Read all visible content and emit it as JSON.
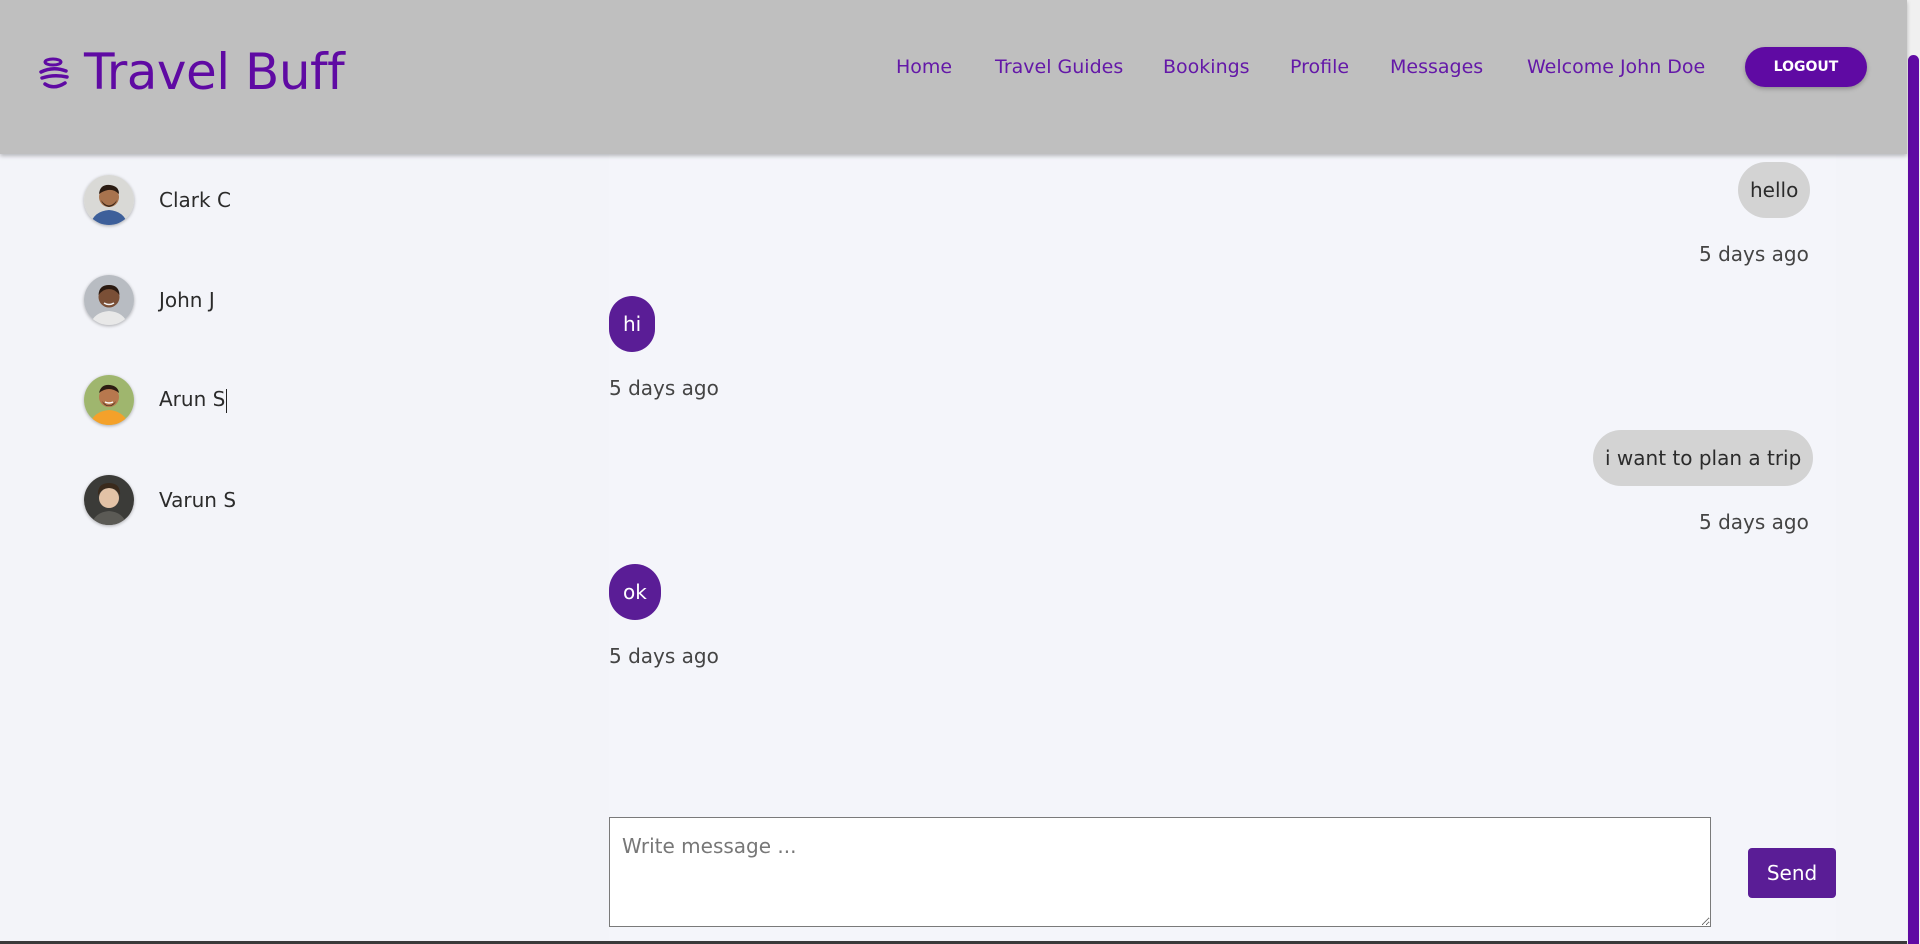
{
  "header": {
    "brand": "Travel Buff",
    "nav": [
      {
        "label": "Home"
      },
      {
        "label": "Travel Guides"
      },
      {
        "label": "Bookings"
      },
      {
        "label": "Profile"
      },
      {
        "label": "Messages"
      },
      {
        "label": "Welcome John Doe"
      }
    ],
    "logout_label": "LOGOUT"
  },
  "contacts": [
    {
      "name": "Clark C"
    },
    {
      "name": "John J"
    },
    {
      "name": "Arun S"
    },
    {
      "name": "Varun S"
    }
  ],
  "messages": [
    {
      "text": "hello",
      "time": "5 days ago",
      "side": "sent"
    },
    {
      "text": "hi",
      "time": "5 days ago",
      "side": "received"
    },
    {
      "text": "i want to plan a trip",
      "time": "5 days ago",
      "side": "sent"
    },
    {
      "text": "ok",
      "time": "5 days ago",
      "side": "received"
    }
  ],
  "composer": {
    "placeholder": "Write message ...",
    "value": "",
    "send_label": "Send"
  },
  "colors": {
    "brand": "#5f0aa3",
    "header_bg": "#bfbfbf",
    "received_bubble": "#5a1d96",
    "sent_bubble": "#d3d3d3",
    "page_bg": "#f3f4f9"
  }
}
